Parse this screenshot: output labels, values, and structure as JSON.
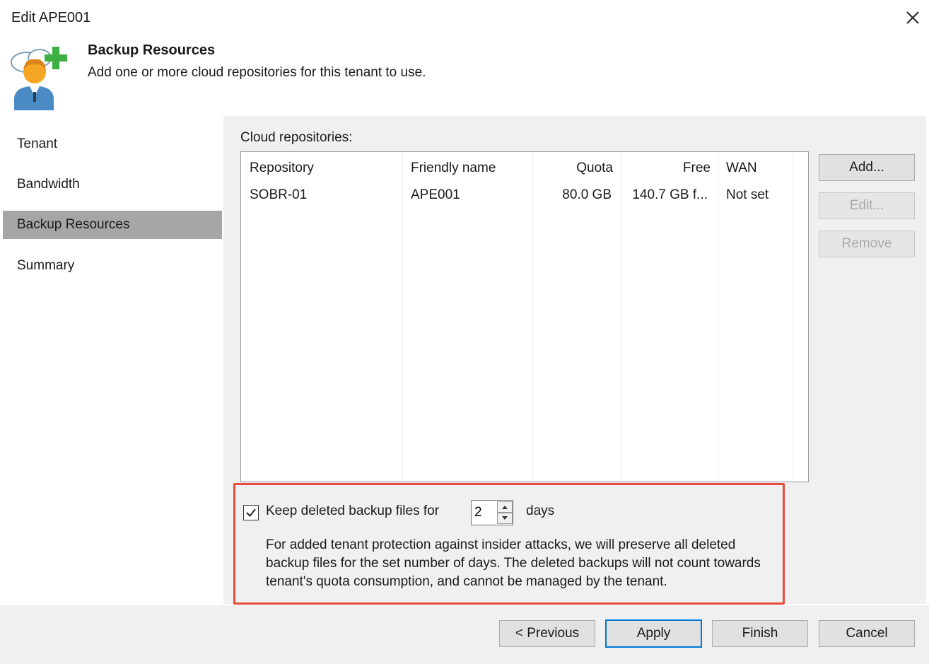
{
  "window": {
    "title": "Edit APE001"
  },
  "header": {
    "title": "Backup Resources",
    "description": "Add one or more cloud repositories for this tenant to use."
  },
  "sidebar": {
    "items": [
      {
        "label": "Tenant"
      },
      {
        "label": "Bandwidth"
      },
      {
        "label": "Backup Resources",
        "active": true
      },
      {
        "label": "Summary"
      }
    ]
  },
  "repositories": {
    "label": "Cloud repositories:",
    "columns": [
      "Repository",
      "Friendly name",
      "Quota",
      "Free",
      "WAN"
    ],
    "rows": [
      [
        "SOBR-01",
        "APE001",
        "80.0 GB",
        "140.7 GB f...",
        "Not set"
      ]
    ]
  },
  "actions": {
    "add": "Add...",
    "edit": "Edit...",
    "remove": "Remove"
  },
  "retention": {
    "checked": true,
    "label": "Keep deleted backup files for",
    "value": "2",
    "unit": "days",
    "help": "For added tenant protection against insider attacks, we will preserve all deleted backup files for the set number of days. The deleted backups will not count towards tenant's quota consumption, and cannot be managed by the tenant."
  },
  "footer": {
    "previous": "< Previous",
    "apply": "Apply",
    "finish": "Finish",
    "cancel": "Cancel"
  },
  "colors": {
    "highlight": "#e74c3c",
    "accent": "#0078d7",
    "active_nav": "#a6a6a6"
  }
}
